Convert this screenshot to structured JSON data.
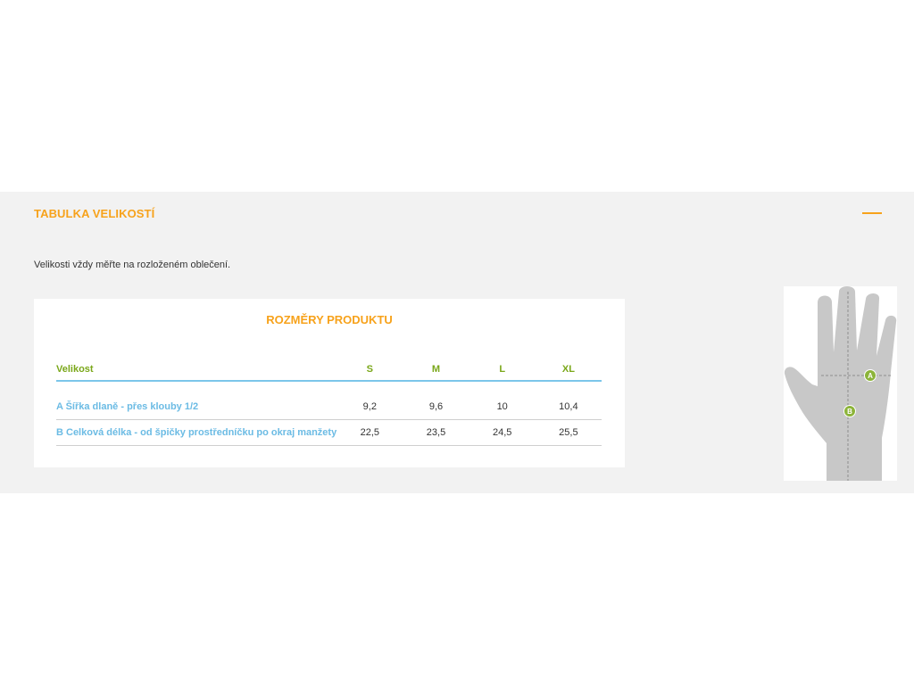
{
  "section": {
    "title": "TABULKA VELIKOSTÍ",
    "collapse_icon": "minus-icon",
    "note": "Velikosti vždy měřte na rozloženém oblečení."
  },
  "table_card": {
    "title": "ROZMĚRY PRODUKTU",
    "header": {
      "label": "Velikost",
      "sizes": [
        "S",
        "M",
        "L",
        "XL"
      ]
    },
    "rows": [
      {
        "label": "A Šířka dlaně - přes klouby 1/2",
        "values": [
          "9,2",
          "9,6",
          "10",
          "10,4"
        ]
      },
      {
        "label": "B Celková délka - od špičky prostředníčku po okraj manžety",
        "values": [
          "22,5",
          "23,5",
          "24,5",
          "25,5"
        ]
      }
    ]
  },
  "hand_diagram": {
    "icon": "hand-measurement-icon",
    "marker_a": "A",
    "marker_b": "B"
  },
  "colors": {
    "accent_orange": "#f7a21b",
    "header_green": "#7aa719",
    "row_label_blue": "#6bbbe4",
    "panel_gray": "#f2f2f2",
    "hand_gray": "#c8c8c8",
    "marker_green": "#8cb43a"
  }
}
